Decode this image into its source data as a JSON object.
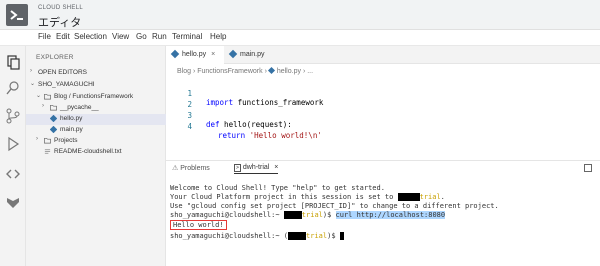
{
  "app": {
    "subtitle": "CLOUD SHELL",
    "title": "エディタ"
  },
  "menu": [
    "File",
    "Edit",
    "Selection",
    "View",
    "Go",
    "Run",
    "Terminal",
    "Help"
  ],
  "sidebar": {
    "header": "EXPLORER",
    "open_editors": "OPEN EDITORS",
    "root": "SHO_YAMAGUCHI",
    "items": [
      {
        "label": "Blog / FunctionsFramework"
      },
      {
        "label": "__pycache__"
      },
      {
        "label": "hello.py"
      },
      {
        "label": "main.py"
      },
      {
        "label": "Projects"
      },
      {
        "label": "README-cloudshell.txt"
      }
    ]
  },
  "editor": {
    "tabs": [
      {
        "label": "hello.py",
        "close": "×"
      },
      {
        "label": "main.py"
      }
    ],
    "breadcrumb": [
      "Blog",
      "FunctionsFramework",
      "hello.py",
      "..."
    ],
    "lines": [
      {
        "num": "1",
        "kw": "import",
        "rest": " functions_framework"
      },
      {
        "num": "2",
        "kw": "",
        "rest": ""
      },
      {
        "num": "3",
        "kw": "def",
        "rest": " hello(request):"
      },
      {
        "num": "4",
        "kw": "return",
        "str": "'Hello world!\\n'"
      }
    ]
  },
  "panel": {
    "tabs": [
      {
        "label": "Problems"
      },
      {
        "label": "dwh-trial"
      }
    ],
    "terminal": {
      "welcome": "Welcome to Cloud Shell! Type \"help\" to get started.",
      "project_line": "Your Cloud Platform project in this session is set to",
      "trial": "trial",
      "gcloud_line": "Use \"gcloud config set project [PROJECT_ID]\" to change to a different project.",
      "prompt": "sho_yamaguchi@cloudshell:~",
      "command": "curl http://localhost:8080",
      "output": "Hello world!",
      "dollar": "$"
    }
  },
  "colors": {
    "accent": "#3572a5",
    "trial": "#c8a000",
    "highlight_box": "#e53935"
  }
}
